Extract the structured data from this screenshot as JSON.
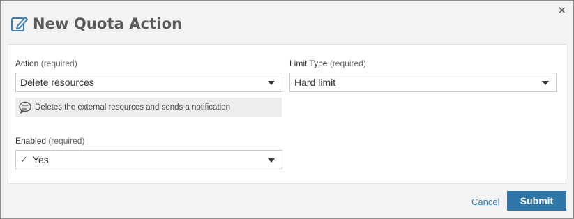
{
  "dialog": {
    "title": "New Quota Action",
    "title_icon": "edit-pencil-icon",
    "close_glyph": "✕"
  },
  "form": {
    "action": {
      "label": "Action",
      "required_text": "(required)",
      "value": "Delete resources",
      "hint_icon": "speech-bubble-icon",
      "hint": "Deletes the external resources and sends a notification"
    },
    "limit_type": {
      "label": "Limit Type",
      "required_text": "(required)",
      "value": "Hard limit"
    },
    "enabled": {
      "label": "Enabled",
      "required_text": "(required)",
      "value": "Yes",
      "value_icon": "checkmark-icon"
    }
  },
  "footer": {
    "cancel_label": "Cancel",
    "submit_label": "Submit"
  },
  "colors": {
    "accent": "#2f77a8",
    "link": "#3a7db5",
    "background": "#f3f3f3",
    "panel": "#ffffff"
  }
}
